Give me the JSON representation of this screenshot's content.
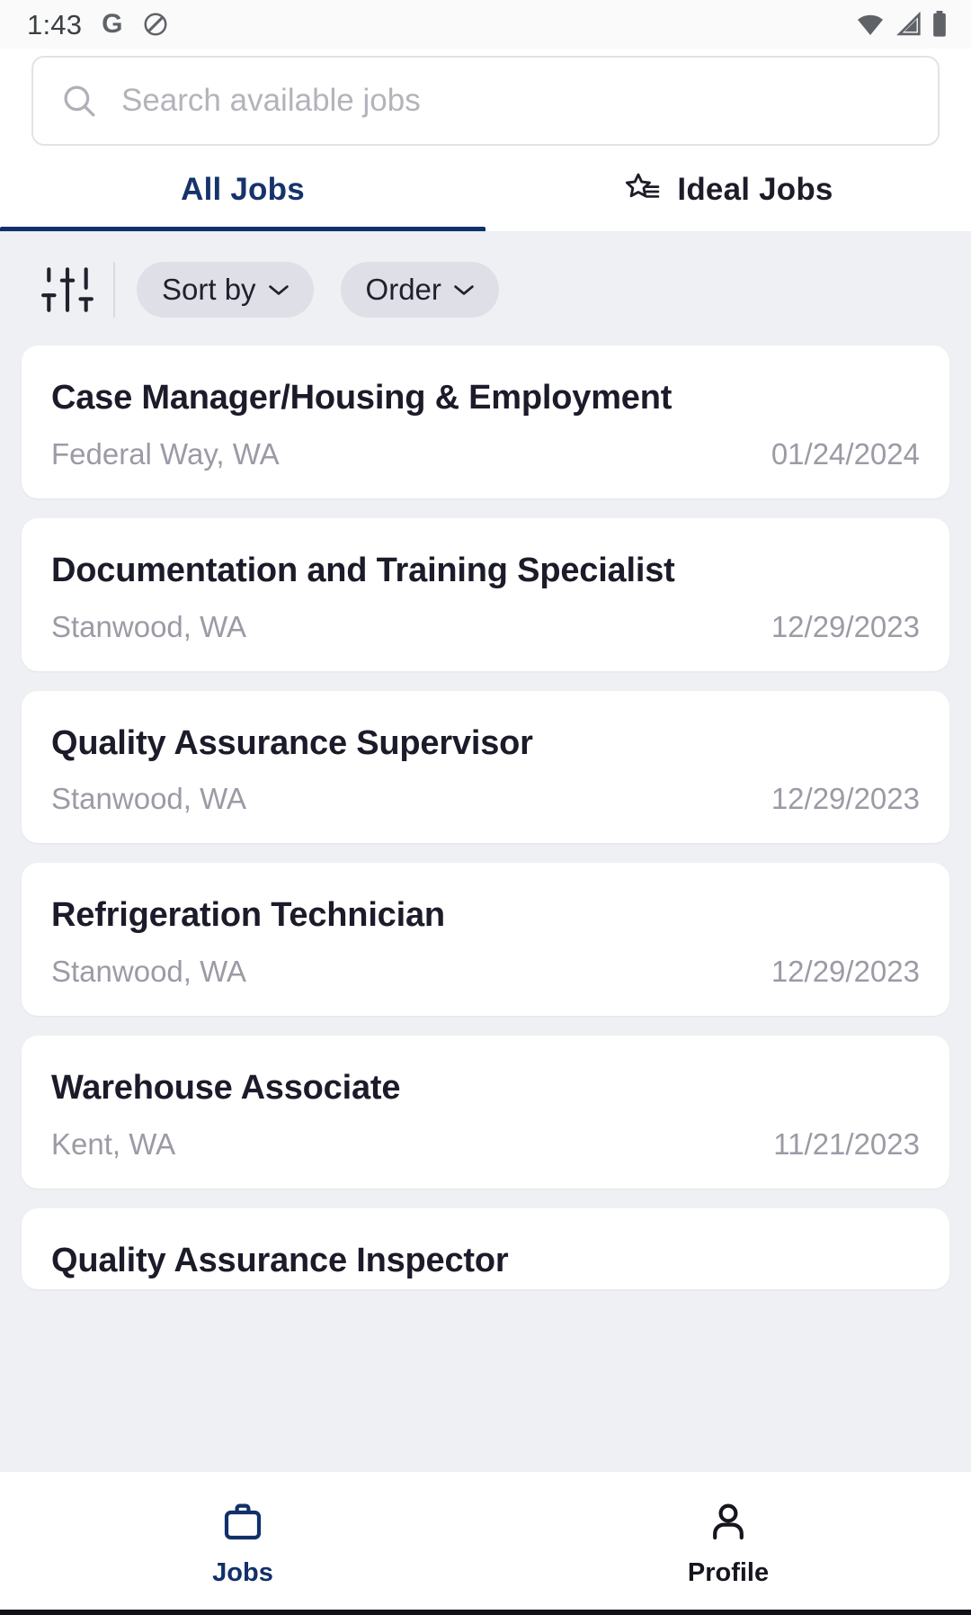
{
  "status_bar": {
    "time": "1:43",
    "icons": [
      "google-icon",
      "do-not-disturb-icon",
      "wifi-icon",
      "cellular-icon",
      "battery-icon"
    ]
  },
  "search": {
    "placeholder": "Search available jobs",
    "value": "",
    "icon": "search-icon"
  },
  "tabs": [
    {
      "label": "All Jobs",
      "active": true,
      "icon": null
    },
    {
      "label": "Ideal Jobs",
      "active": false,
      "icon": "star-list-icon"
    }
  ],
  "filters": {
    "tune_icon": "tune-icon",
    "pills": [
      {
        "label": "Sort by",
        "icon": "chevron-down-icon"
      },
      {
        "label": "Order",
        "icon": "chevron-down-icon"
      }
    ]
  },
  "jobs": [
    {
      "title": "Case Manager/Housing & Employment",
      "location": "Federal Way, WA",
      "date": "01/24/2024"
    },
    {
      "title": "Documentation and Training Specialist",
      "location": "Stanwood, WA",
      "date": "12/29/2023"
    },
    {
      "title": "Quality Assurance Supervisor",
      "location": "Stanwood, WA",
      "date": "12/29/2023"
    },
    {
      "title": "Refrigeration Technician",
      "location": "Stanwood, WA",
      "date": "12/29/2023"
    },
    {
      "title": "Warehouse Associate",
      "location": "Kent, WA",
      "date": "11/21/2023"
    },
    {
      "title": "Quality Assurance Inspector",
      "location": "",
      "date": ""
    }
  ],
  "bottom_nav": [
    {
      "label": "Jobs",
      "icon": "briefcase-icon",
      "active": true
    },
    {
      "label": "Profile",
      "icon": "person-icon",
      "active": false
    }
  ],
  "colors": {
    "accent": "#11306b",
    "page_bg": "#eff0f4",
    "card_bg": "#ffffff",
    "muted_text": "#9b9ba6",
    "title_text": "#1b1b2a",
    "pill_bg": "#dedfe7"
  }
}
